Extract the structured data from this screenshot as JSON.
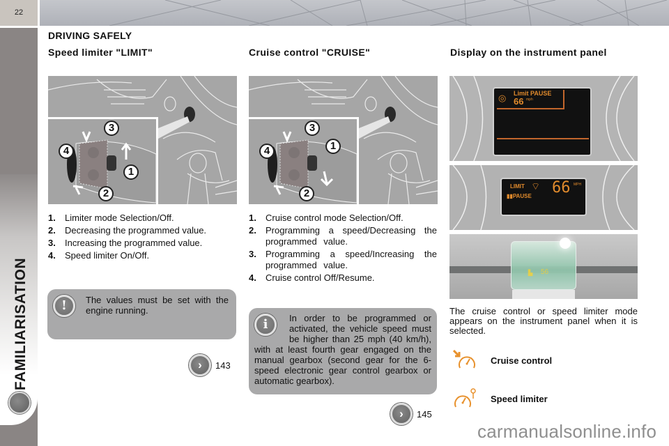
{
  "page": {
    "number": "22",
    "section": "FAMILIARISATION",
    "chapter": "DRIVING SAFELY"
  },
  "columns": {
    "limiter": {
      "title": "Speed limiter \"LIMIT\"",
      "callouts": [
        "1",
        "2",
        "3",
        "4"
      ],
      "steps": [
        {
          "num": "1.",
          "text": "Limiter mode Selection/Off."
        },
        {
          "num": "2.",
          "text": "Decreasing the programmed value."
        },
        {
          "num": "3.",
          "text": "Increasing the programmed value."
        },
        {
          "num": "4.",
          "text": "Speed limiter On/Off."
        }
      ],
      "note": {
        "icon": "!",
        "text": "The values must be set with the engine running."
      },
      "reference": {
        "icon": "›",
        "page": "143"
      }
    },
    "cruise": {
      "title": "Cruise control \"CRUISE\"",
      "callouts": [
        "1",
        "2",
        "3",
        "4"
      ],
      "steps": [
        {
          "num": "1.",
          "text": "Cruise control mode Selection/Off."
        },
        {
          "num": "2.",
          "text": "Programming a speed/Decreasing the programmed value."
        },
        {
          "num": "3.",
          "text": "Programming a speed/Increasing the programmed value."
        },
        {
          "num": "4.",
          "text": "Cruise control Off/Resume."
        }
      ],
      "note": {
        "icon": "i",
        "text": "In order to be programmed or activated, the vehicle speed must be higher than 25 mph (40 km/h), with at least fourth gear engaged on the manual gearbox (second gear for the 6-speed electronic gear control gearbox or automatic gearbox)."
      },
      "reference": {
        "icon": "›",
        "page": "145"
      }
    },
    "display": {
      "title": "Display on the instrument panel",
      "screen1": {
        "mode": "Limit PAUSE",
        "speed": "66",
        "unit": "mph"
      },
      "screen2": {
        "mode": "LIMIT",
        "status": "PAUSE",
        "speed": "66",
        "unit": "MPH"
      },
      "screen3": {
        "speed": "56"
      },
      "description": "The cruise control or speed limiter mode appears on the instrument panel when it is selected.",
      "legend": [
        {
          "icon": "cruise-control-icon",
          "label": "Cruise control"
        },
        {
          "icon": "speed-limiter-icon",
          "label": "Speed limiter"
        }
      ],
      "accent_color": "#e8922e"
    }
  },
  "watermark": "carmanualsonline.info"
}
